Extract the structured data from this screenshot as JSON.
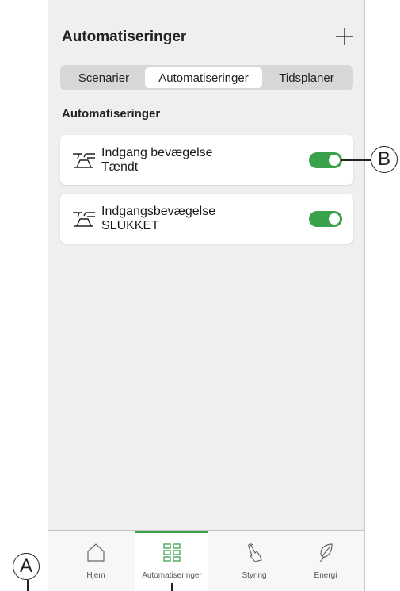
{
  "header": {
    "title": "Automatiseringer",
    "add_icon": "plus-icon"
  },
  "segments": [
    {
      "label": "Scenarier",
      "selected": false
    },
    {
      "label": "Automatiseringer",
      "selected": true
    },
    {
      "label": "Tidsplaner",
      "selected": false
    }
  ],
  "section_title": "Automatiseringer",
  "automations": [
    {
      "name": "Indgang bevægelse",
      "state": "Tændt",
      "icon": "motion-sensor-icon",
      "enabled": true
    },
    {
      "name": "Indgangsbevægelse",
      "state": "SLUKKET",
      "icon": "motion-sensor-icon",
      "enabled": true
    }
  ],
  "colors": {
    "accent": "#3aa24b",
    "background": "#efefef"
  },
  "tabbar": [
    {
      "label": "Hjem",
      "icon": "home-icon",
      "active": false
    },
    {
      "label": "Automatiseringer",
      "icon": "grid-icon",
      "active": true
    },
    {
      "label": "Styring",
      "icon": "hand-pointer-icon",
      "active": false
    },
    {
      "label": "Energi",
      "icon": "leaf-icon",
      "active": false
    }
  ],
  "callouts": {
    "a": "A",
    "b": "B"
  }
}
